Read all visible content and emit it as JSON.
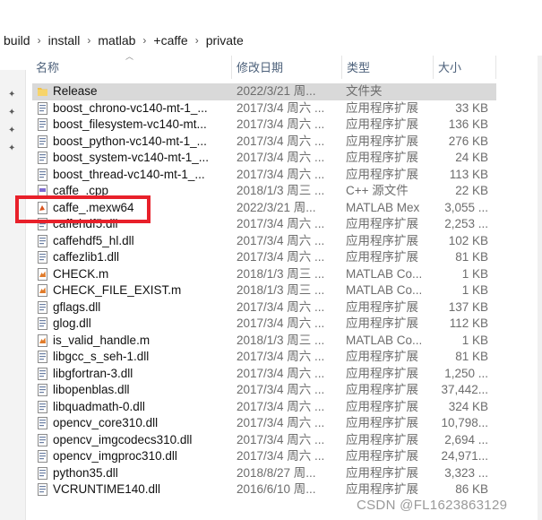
{
  "breadcrumb": [
    "build",
    "install",
    "matlab",
    "+caffe",
    "private"
  ],
  "columns": {
    "name": "名称",
    "date": "修改日期",
    "type": "类型",
    "size": "大小"
  },
  "files": [
    {
      "name": "Release",
      "date": "2022/3/21 周...",
      "type": "文件夹",
      "size": "",
      "icon": "folder-icon",
      "selected": true
    },
    {
      "name": "boost_chrono-vc140-mt-1_...",
      "date": "2017/3/4 周六 ...",
      "type": "应用程序扩展",
      "size": "33 KB",
      "icon": "dll-file-icon"
    },
    {
      "name": "boost_filesystem-vc140-mt...",
      "date": "2017/3/4 周六 ...",
      "type": "应用程序扩展",
      "size": "136 KB",
      "icon": "dll-file-icon"
    },
    {
      "name": "boost_python-vc140-mt-1_...",
      "date": "2017/3/4 周六 ...",
      "type": "应用程序扩展",
      "size": "276 KB",
      "icon": "dll-file-icon"
    },
    {
      "name": "boost_system-vc140-mt-1_...",
      "date": "2017/3/4 周六 ...",
      "type": "应用程序扩展",
      "size": "24 KB",
      "icon": "dll-file-icon"
    },
    {
      "name": "boost_thread-vc140-mt-1_...",
      "date": "2017/3/4 周六 ...",
      "type": "应用程序扩展",
      "size": "113 KB",
      "icon": "dll-file-icon"
    },
    {
      "name": "caffe_.cpp",
      "date": "2018/1/3 周三 ...",
      "type": "C++ 源文件",
      "size": "22 KB",
      "icon": "cpp-file-icon"
    },
    {
      "name": "caffe_.mexw64",
      "date": "2022/3/21 周...",
      "type": "MATLAB Mex",
      "size": "3,055 ...",
      "icon": "mex-file-icon"
    },
    {
      "name": "caffehdf5.dll",
      "date": "2017/3/4 周六 ...",
      "type": "应用程序扩展",
      "size": "2,253 ...",
      "icon": "dll-file-icon"
    },
    {
      "name": "caffehdf5_hl.dll",
      "date": "2017/3/4 周六 ...",
      "type": "应用程序扩展",
      "size": "102 KB",
      "icon": "dll-file-icon"
    },
    {
      "name": "caffezlib1.dll",
      "date": "2017/3/4 周六 ...",
      "type": "应用程序扩展",
      "size": "81 KB",
      "icon": "dll-file-icon"
    },
    {
      "name": "CHECK.m",
      "date": "2018/1/3 周三 ...",
      "type": "MATLAB Co...",
      "size": "1 KB",
      "icon": "matlab-file-icon"
    },
    {
      "name": "CHECK_FILE_EXIST.m",
      "date": "2018/1/3 周三 ...",
      "type": "MATLAB Co...",
      "size": "1 KB",
      "icon": "matlab-file-icon"
    },
    {
      "name": "gflags.dll",
      "date": "2017/3/4 周六 ...",
      "type": "应用程序扩展",
      "size": "137 KB",
      "icon": "dll-file-icon"
    },
    {
      "name": "glog.dll",
      "date": "2017/3/4 周六 ...",
      "type": "应用程序扩展",
      "size": "112 KB",
      "icon": "dll-file-icon"
    },
    {
      "name": "is_valid_handle.m",
      "date": "2018/1/3 周三 ...",
      "type": "MATLAB Co...",
      "size": "1 KB",
      "icon": "matlab-file-icon"
    },
    {
      "name": "libgcc_s_seh-1.dll",
      "date": "2017/3/4 周六 ...",
      "type": "应用程序扩展",
      "size": "81 KB",
      "icon": "dll-file-icon"
    },
    {
      "name": "libgfortran-3.dll",
      "date": "2017/3/4 周六 ...",
      "type": "应用程序扩展",
      "size": "1,250 ...",
      "icon": "dll-file-icon"
    },
    {
      "name": "libopenblas.dll",
      "date": "2017/3/4 周六 ...",
      "type": "应用程序扩展",
      "size": "37,442...",
      "icon": "dll-file-icon"
    },
    {
      "name": "libquadmath-0.dll",
      "date": "2017/3/4 周六 ...",
      "type": "应用程序扩展",
      "size": "324 KB",
      "icon": "dll-file-icon"
    },
    {
      "name": "opencv_core310.dll",
      "date": "2017/3/4 周六 ...",
      "type": "应用程序扩展",
      "size": "10,798...",
      "icon": "dll-file-icon"
    },
    {
      "name": "opencv_imgcodecs310.dll",
      "date": "2017/3/4 周六 ...",
      "type": "应用程序扩展",
      "size": "2,694 ...",
      "icon": "dll-file-icon"
    },
    {
      "name": "opencv_imgproc310.dll",
      "date": "2017/3/4 周六 ...",
      "type": "应用程序扩展",
      "size": "24,971...",
      "icon": "dll-file-icon"
    },
    {
      "name": "python35.dll",
      "date": "2018/8/27 周...",
      "type": "应用程序扩展",
      "size": "3,323 ...",
      "icon": "dll-file-icon"
    },
    {
      "name": "VCRUNTIME140.dll",
      "date": "2016/6/10 周...",
      "type": "应用程序扩展",
      "size": "86 KB",
      "icon": "dll-file-icon"
    }
  ],
  "watermark": "CSDN @FL1623863129",
  "colors": {
    "highlight": "#e8202a",
    "selected_row": "#d9d9d9",
    "folder": "#f0c24b"
  }
}
